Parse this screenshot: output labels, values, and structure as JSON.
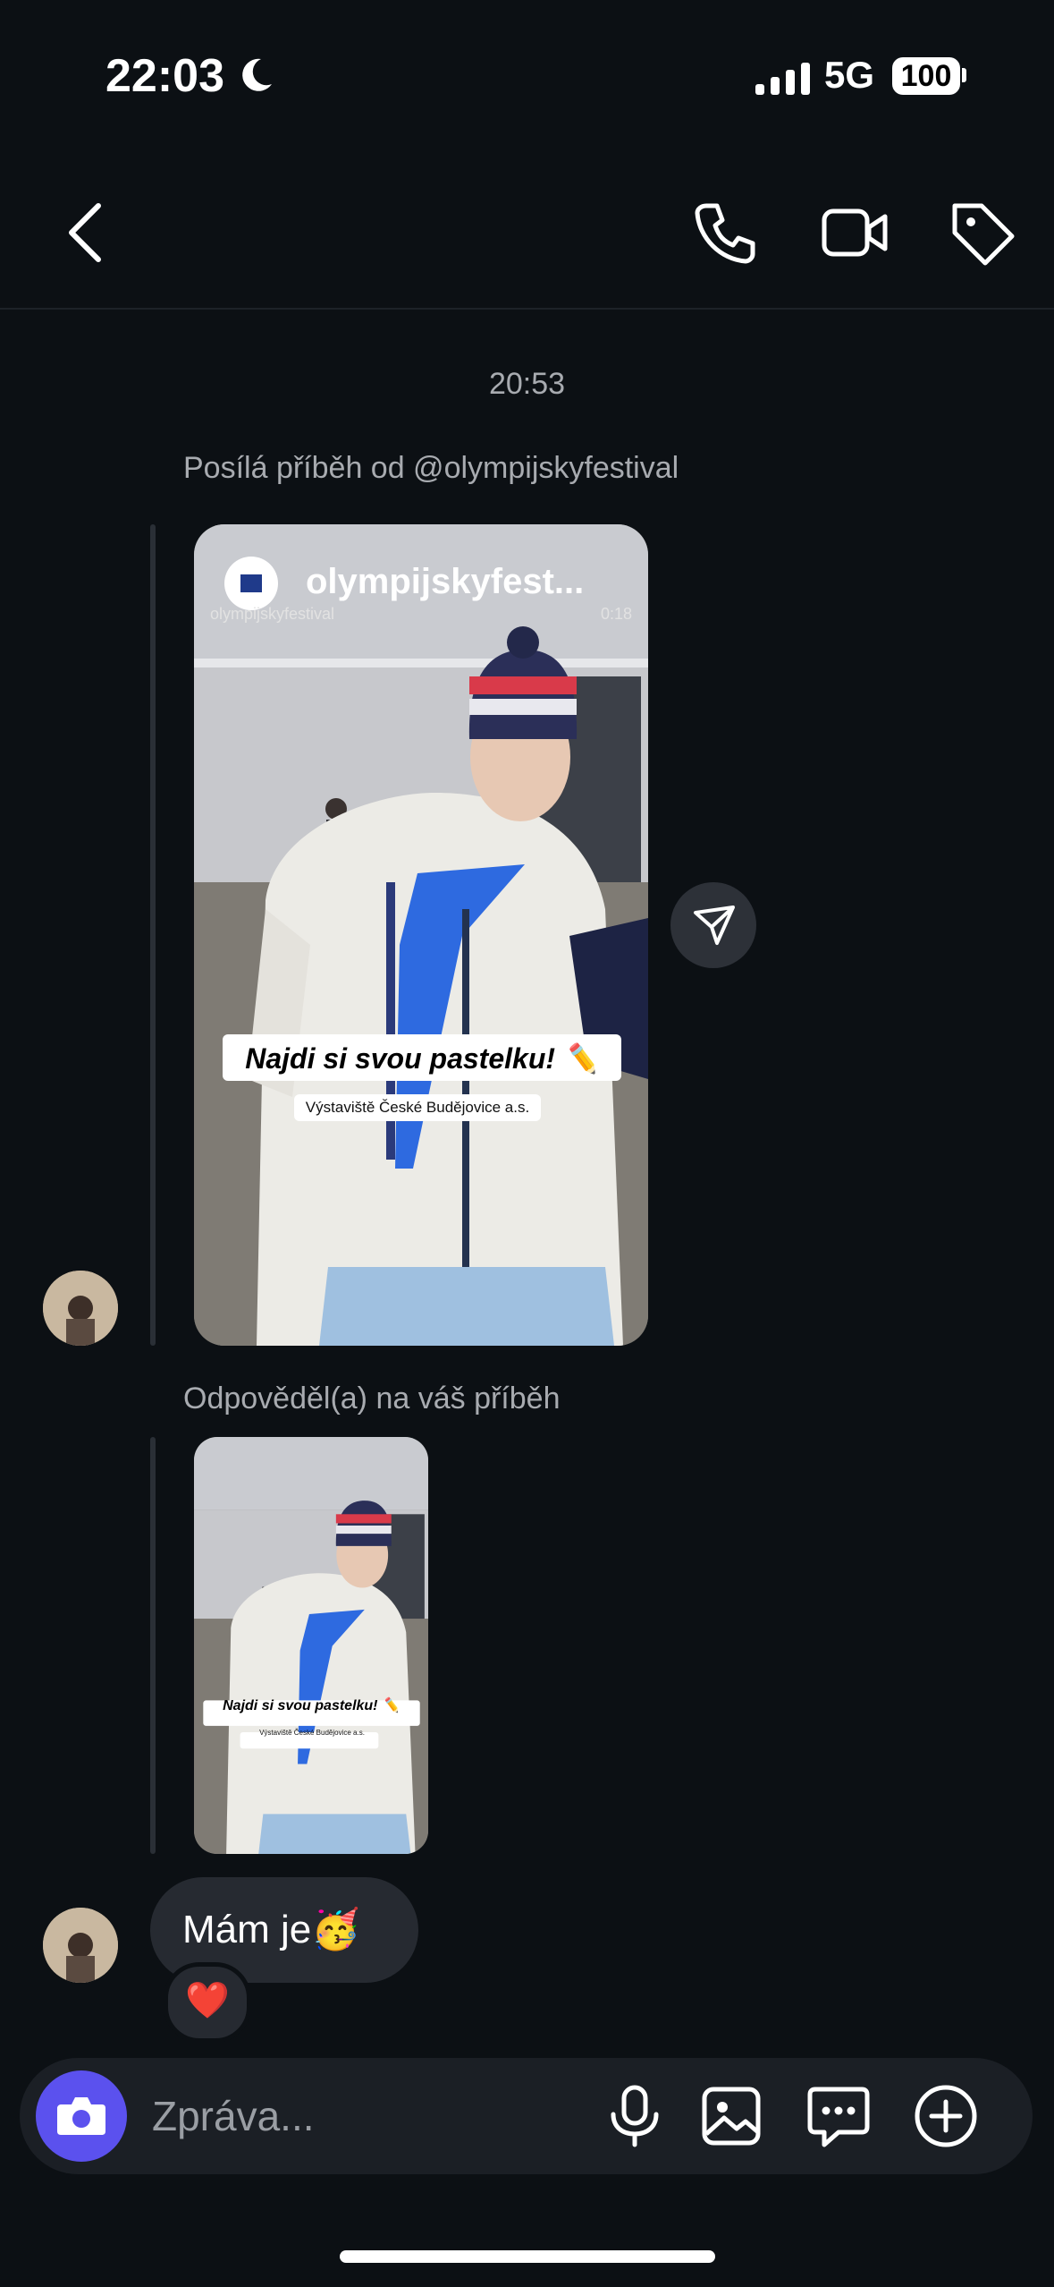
{
  "status_bar": {
    "time": "22:03",
    "network": "5G",
    "battery": "100"
  },
  "header": {
    "back_icon": "chevron-left-icon",
    "call_icon": "phone-icon",
    "video_icon": "video-camera-icon",
    "tag_icon": "tag-icon"
  },
  "thread": {
    "timestamp": "20:53",
    "shared_story": {
      "note": "Posílá příběh od @olympijskyfestival",
      "account": "olympijskyfest...",
      "account_small": "olympijskyfestival",
      "duration": "0:18",
      "caption": "Najdi si svou pastelku! ✏️",
      "location": "Výstaviště České Budějovice a.s."
    },
    "reply_story": {
      "note": "Odpověděl(a) na váš příběh",
      "caption": "Najdi si svou pastelku! ✏️",
      "location": "Výstaviště České Budějovice a.s."
    },
    "message": {
      "text": "Mám je🥳",
      "reaction": "❤️"
    }
  },
  "composer": {
    "placeholder": "Zpráva..."
  },
  "colors": {
    "background": "#0c1014",
    "bubble": "#262a31",
    "accent": "#5b51ee"
  }
}
